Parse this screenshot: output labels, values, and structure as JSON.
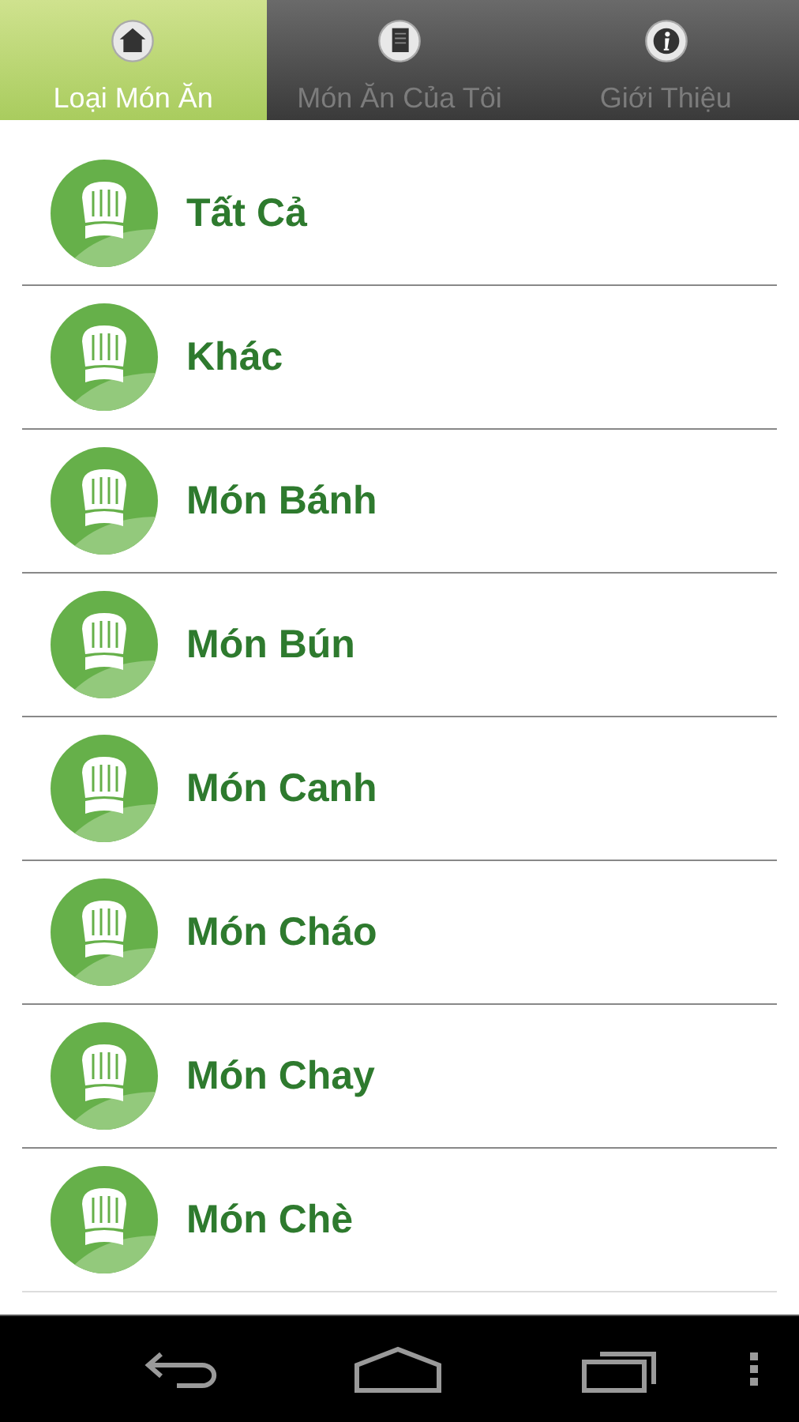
{
  "tabs": [
    {
      "label": "Loại Món Ăn",
      "kind": "home",
      "selected": true
    },
    {
      "label": "Món Ăn Của Tôi",
      "kind": "document",
      "selected": false
    },
    {
      "label": "Giới Thiệu",
      "kind": "info",
      "selected": false
    }
  ],
  "categories": [
    {
      "name": "Tất Cả"
    },
    {
      "name": "Khác"
    },
    {
      "name": "Món Bánh"
    },
    {
      "name": "Món Bún"
    },
    {
      "name": "Món Canh"
    },
    {
      "name": "Món Cháo"
    },
    {
      "name": "Món Chay"
    },
    {
      "name": "Món Chè"
    }
  ]
}
